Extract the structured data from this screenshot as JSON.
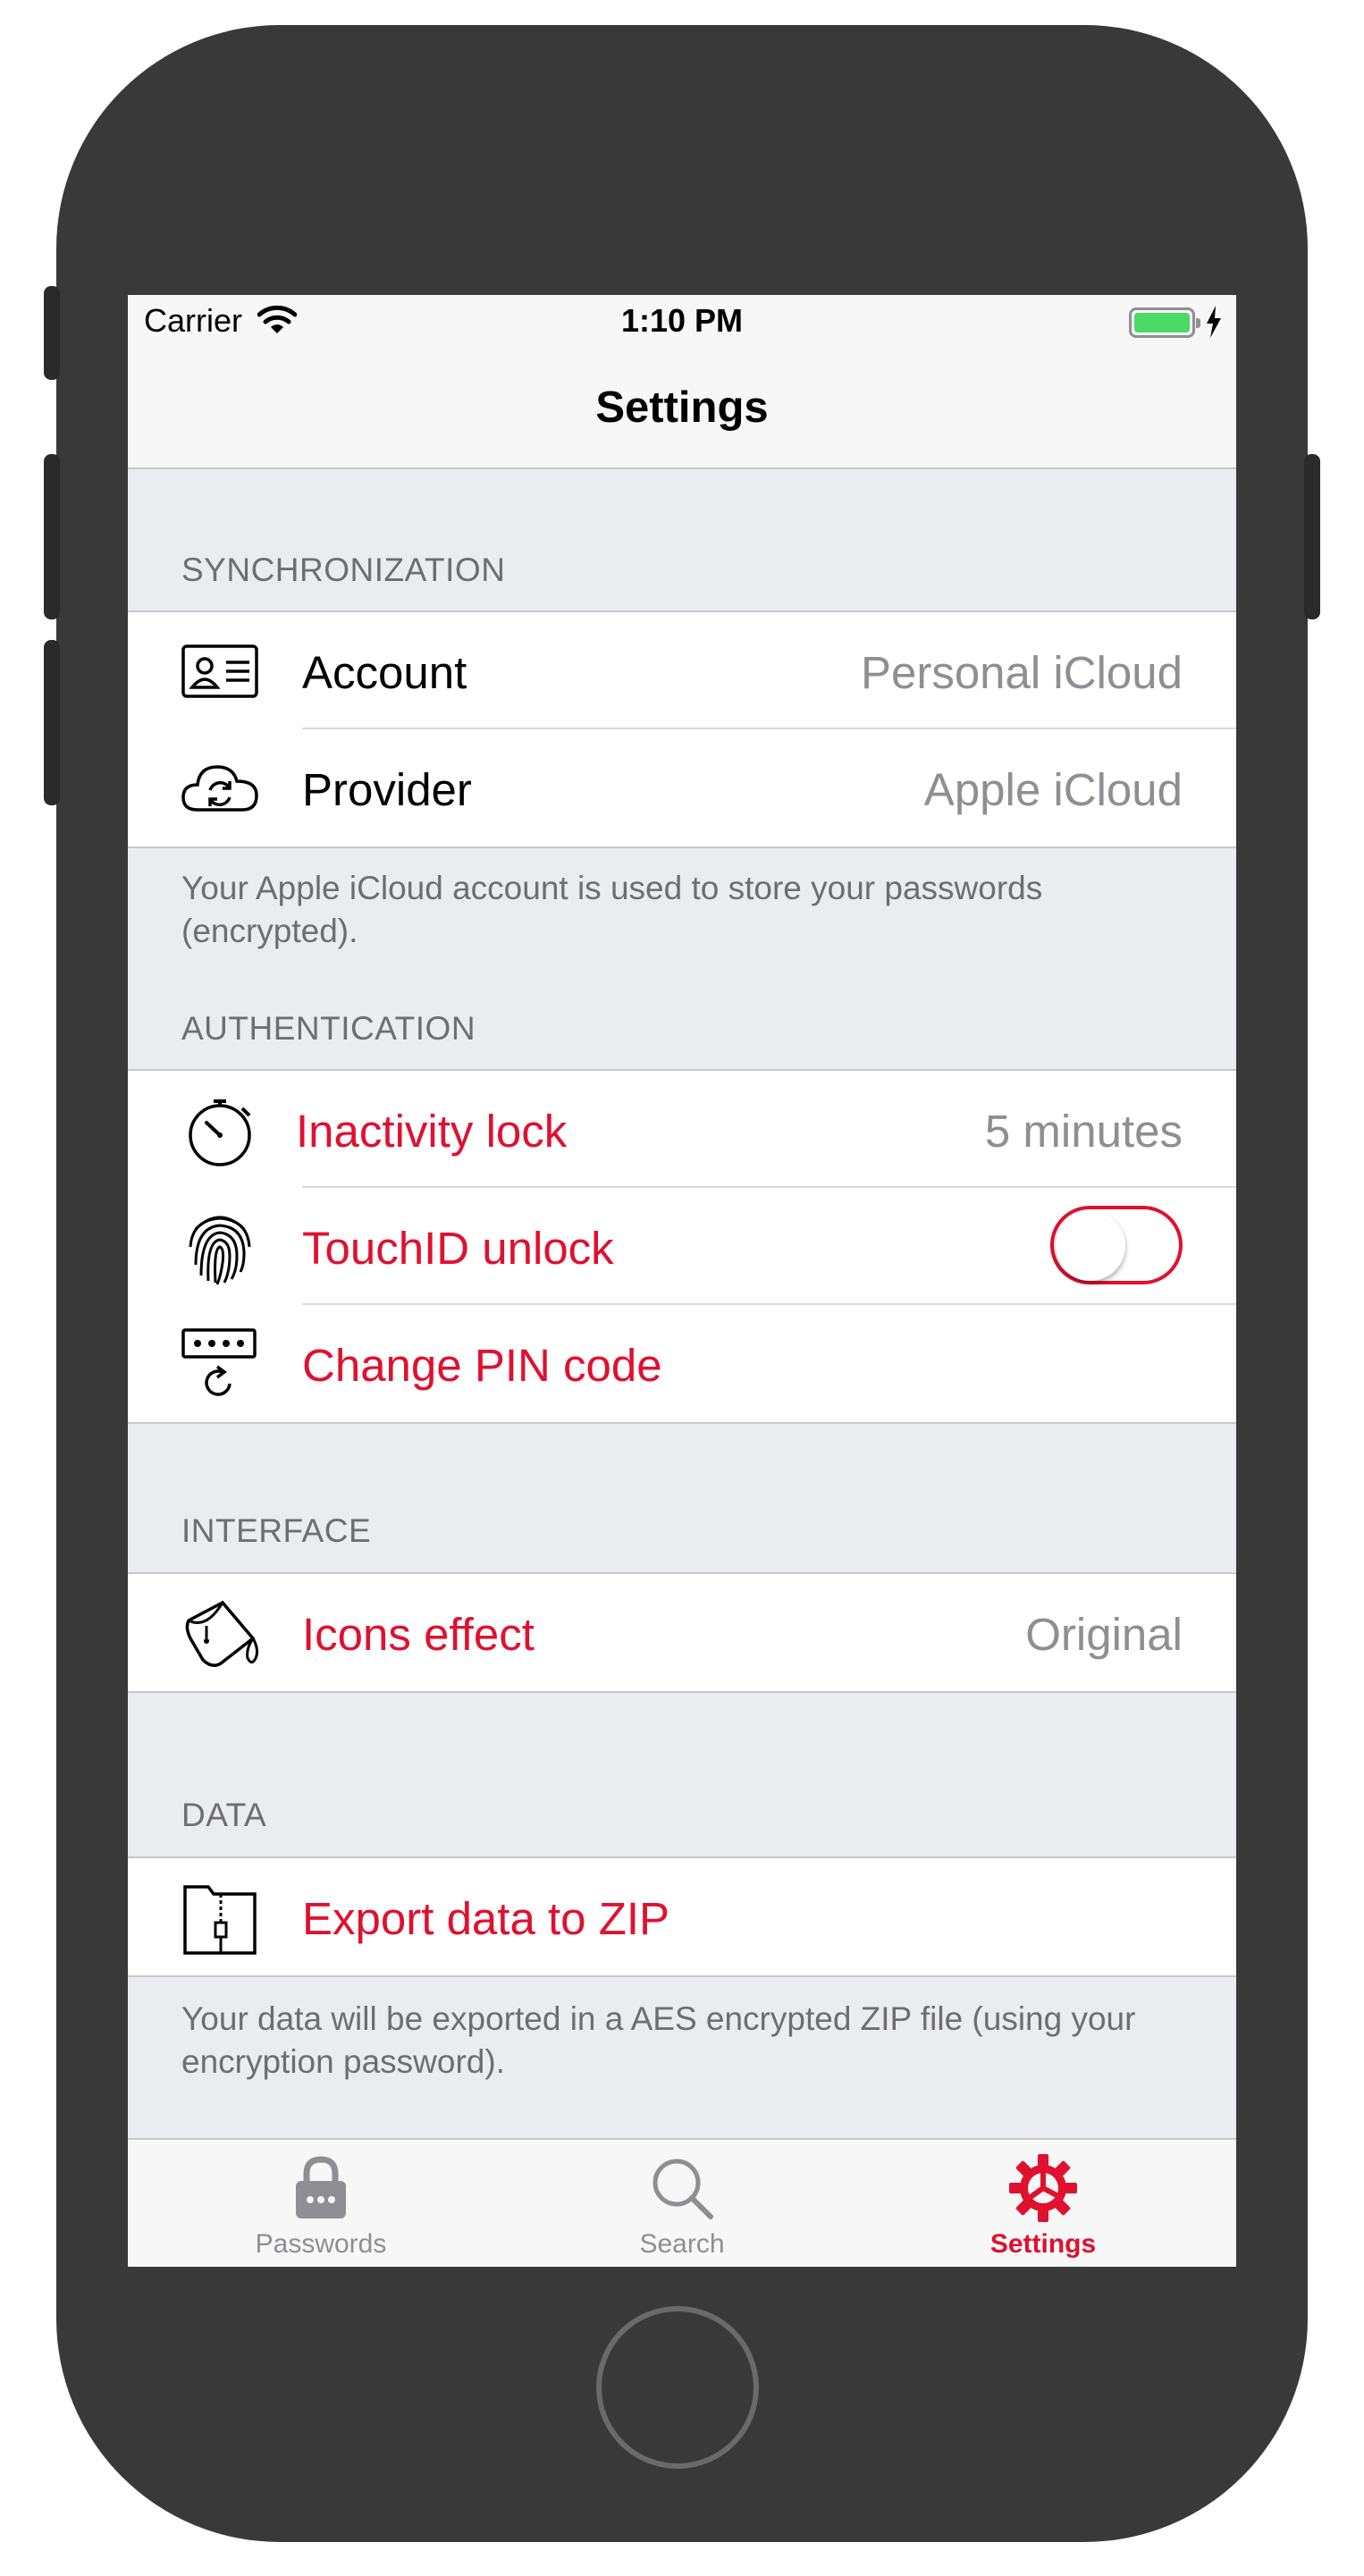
{
  "statusbar": {
    "carrier": "Carrier",
    "time": "1:10 PM"
  },
  "navbar": {
    "title": "Settings"
  },
  "sections": {
    "sync": {
      "header": "SYNCHRONIZATION",
      "rows": [
        {
          "label": "Account",
          "value": "Personal iCloud",
          "icon": "id-card-icon"
        },
        {
          "label": "Provider",
          "value": "Apple iCloud",
          "icon": "cloud-sync-icon"
        }
      ],
      "footer": "Your Apple iCloud account is used to store your passwords (encrypted)."
    },
    "auth": {
      "header": "AUTHENTICATION",
      "rows": [
        {
          "label": "Inactivity lock",
          "value": "5 minutes",
          "icon": "stopwatch-icon"
        },
        {
          "label": "TouchID unlock",
          "toggle": false,
          "icon": "fingerprint-icon"
        },
        {
          "label": "Change PIN code",
          "icon": "pin-reset-icon"
        }
      ]
    },
    "interface": {
      "header": "INTERFACE",
      "rows": [
        {
          "label": "Icons effect",
          "value": "Original",
          "icon": "paint-bucket-icon"
        }
      ]
    },
    "data": {
      "header": "DATA",
      "rows": [
        {
          "label": "Export data to ZIP",
          "icon": "zip-file-icon"
        }
      ],
      "footer": "Your data will be exported in a AES encrypted ZIP file (using your encryption password)."
    }
  },
  "tabbar": {
    "tabs": [
      {
        "label": "Passwords",
        "icon": "lock-icon",
        "active": false
      },
      {
        "label": "Search",
        "icon": "search-icon",
        "active": false
      },
      {
        "label": "Settings",
        "icon": "gear-icon",
        "active": true
      }
    ]
  },
  "colors": {
    "accent": "#e0102f",
    "background": "#ebecf0",
    "battery": "#4cd964",
    "phone_body": "#393939"
  }
}
